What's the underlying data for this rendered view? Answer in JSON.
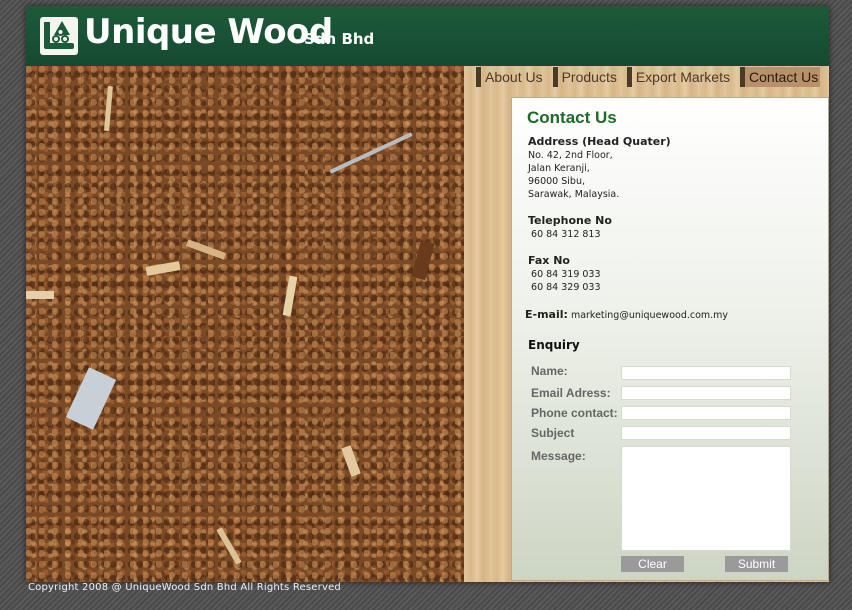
{
  "header": {
    "logo_main": "Unique Wood",
    "logo_sub": "Sdn Bhd"
  },
  "nav": {
    "items": [
      {
        "label": "About Us"
      },
      {
        "label": "Products"
      },
      {
        "label": "Export Markets"
      },
      {
        "label": "Contact Us",
        "active": true
      }
    ]
  },
  "contact": {
    "title": "Contact Us",
    "address_label": "Address (Head Quater)",
    "address_lines": [
      "No. 42, 2nd Floor,",
      "Jalan Keranji,",
      "96000 Sibu,",
      "Sarawak, Malaysia."
    ],
    "telephone_label": "Telephone No",
    "telephone": " 60 84 312 813",
    "fax_label": "Fax No",
    "fax_lines": [
      " 60 84 319 033",
      " 60 84 329 033"
    ],
    "email_label": "E-mail:",
    "email": "marketing@uniquewood.com.my"
  },
  "enquiry": {
    "title": "Enquiry",
    "name_label": "Name:",
    "email_label": "Email Adress:",
    "phone_label": "Phone contact:",
    "subject_label": "Subject",
    "message_label": "Message:",
    "name_value": "",
    "email_value": "",
    "phone_value": "",
    "subject_value": "",
    "message_value": "",
    "clear_label": "Clear",
    "submit_label": "Submit"
  },
  "footer": {
    "copyright": "Copyright 2008 @ UniqueWood Sdn Bhd All Rights Reserved"
  },
  "colors": {
    "header_green": "#1d5a3a",
    "title_green": "#1f6a28",
    "button_gray": "#9a9a9a"
  },
  "icons": {
    "logo": "tree-logo-icon"
  }
}
